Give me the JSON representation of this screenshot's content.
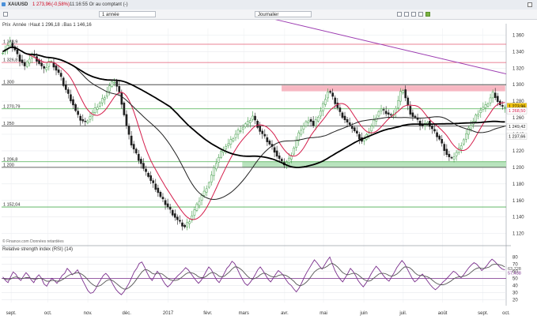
{
  "header": {
    "instrument": "XAUUSD",
    "price": "1 273,96",
    "change": "(-0,58%)",
    "time": "11:16:55 Or au comptant (-)",
    "change_color": "#d0021b",
    "icons": [
      "menu-icon",
      "window-control-icon"
    ]
  },
  "toolbar": {
    "period_label": "1 année",
    "interval_label": "Journalier",
    "icons": [
      "expand-icon",
      "settings-icon",
      "indicator-icon",
      "draw-icon",
      "chart-type-icon",
      "zoom-icon"
    ]
  },
  "chart_data": [
    {
      "type": "candlestick",
      "title": "Prix",
      "info": "Année ↑Haut 1 296,18 ↓Bas 1 146,16",
      "source": "© Finance.com Données retardées",
      "y_ticks": [
        1120,
        1140,
        1160,
        1180,
        1200,
        1220,
        1240,
        1260,
        1280,
        1300,
        1320,
        1340,
        1360
      ],
      "ylim": [
        1112,
        1368
      ],
      "x_tick_labels": [
        "sept.",
        "oct.",
        "nov.",
        "déc.",
        "2017",
        "févr.",
        "mars",
        "avr.",
        "mai",
        "juin",
        "juil.",
        "août",
        "sept.",
        "oct."
      ],
      "x_tick_fractions": [
        0.019,
        0.092,
        0.171,
        0.248,
        0.33,
        0.409,
        0.48,
        0.561,
        0.638,
        0.718,
        0.796,
        0.874,
        0.954,
        1.0
      ],
      "series_close": [
        1340,
        1343,
        1347,
        1350,
        1346,
        1342,
        1336,
        1330,
        1327,
        1322,
        1326,
        1332,
        1336,
        1334,
        1330,
        1326,
        1322,
        1318,
        1322,
        1328,
        1327,
        1323,
        1318,
        1314,
        1308,
        1300,
        1294,
        1288,
        1282,
        1276,
        1268,
        1262,
        1258,
        1256,
        1254,
        1258,
        1262,
        1266,
        1270,
        1274,
        1278,
        1282,
        1286,
        1292,
        1298,
        1302,
        1304,
        1298,
        1290,
        1278,
        1264,
        1250,
        1238,
        1228,
        1222,
        1216,
        1210,
        1205,
        1198,
        1193,
        1190,
        1184,
        1180,
        1175,
        1170,
        1164,
        1160,
        1156,
        1152,
        1148,
        1144,
        1140,
        1136,
        1133,
        1130,
        1128,
        1132,
        1136,
        1142,
        1148,
        1154,
        1160,
        1166,
        1170,
        1176,
        1182,
        1190,
        1198,
        1206,
        1212,
        1218,
        1222,
        1226,
        1228,
        1232,
        1236,
        1240,
        1244,
        1246,
        1249,
        1252,
        1254,
        1258,
        1262,
        1256,
        1250,
        1244,
        1240,
        1236,
        1232,
        1228,
        1224,
        1220,
        1214,
        1210,
        1206,
        1204,
        1206,
        1210,
        1216,
        1224,
        1232,
        1240,
        1246,
        1250,
        1254,
        1258,
        1256,
        1250,
        1256,
        1262,
        1268,
        1276,
        1284,
        1292,
        1290,
        1284,
        1278,
        1272,
        1266,
        1262,
        1258,
        1254,
        1250,
        1248,
        1244,
        1240,
        1236,
        1232,
        1234,
        1238,
        1244,
        1250,
        1256,
        1262,
        1268,
        1270,
        1268,
        1266,
        1264,
        1262,
        1266,
        1272,
        1280,
        1290,
        1294,
        1284,
        1274,
        1266,
        1262,
        1260,
        1256,
        1252,
        1250,
        1252,
        1256,
        1250,
        1246,
        1242,
        1238,
        1234,
        1228,
        1222,
        1216,
        1212,
        1210,
        1214,
        1218,
        1222,
        1228,
        1234,
        1240,
        1246,
        1252,
        1256,
        1262,
        1266,
        1270,
        1272,
        1274,
        1278,
        1284,
        1290,
        1286,
        1280,
        1275,
        1272,
        1274
      ],
      "range_bounds": [
        [
          1314,
          1372
        ],
        [
          1172,
          1262
        ],
        [
          1120,
          1176
        ],
        [
          1192,
          1226
        ],
        [
          1276,
          1298
        ]
      ],
      "moving_averages": [
        {
          "color": "#d41c4a",
          "width": 1.0
        },
        {
          "color": "#222222",
          "width": 1.0
        },
        {
          "color": "#000000",
          "width": 1.8
        }
      ],
      "horizontal_levels": [
        {
          "value": 1348.9,
          "label": "1 348,9",
          "color": "#e35a72"
        },
        {
          "value": 1326.8,
          "label": "1 326,8",
          "color": "#e35a72"
        },
        {
          "value": 1300,
          "label": "1 300",
          "color": "#333333"
        },
        {
          "value": 1270.79,
          "label": "1 270,79",
          "color": "#4caf50"
        },
        {
          "value": 1250,
          "label": "1 250",
          "color": "#333333"
        },
        {
          "value": 1206.8,
          "label": "1 206,8",
          "color": "#4caf50"
        },
        {
          "value": 1200,
          "label": "1 200",
          "color": "#333333"
        },
        {
          "value": 1152.04,
          "label": "1 152,04",
          "color": "#4caf50"
        }
      ],
      "zones": [
        {
          "from": 1292,
          "to": 1299,
          "start_fraction": 0.555,
          "end_fraction": 0.998,
          "color": "#f7b7c2"
        },
        {
          "from": 1200,
          "to": 1206.8,
          "start_fraction": 0.477,
          "end_fraction": 1.0,
          "color": "#b8e3bd"
        }
      ],
      "trendline": {
        "start_fraction": 0.5,
        "start_value": 1385,
        "end_fraction": 1.0,
        "end_value": 1313,
        "color": "#9b3ab0"
      },
      "price_labels": [
        {
          "value": 1273.96,
          "label": "1 273,96",
          "bg": "#f1c40f",
          "fg": "#000000"
        },
        {
          "value": 1268.5,
          "label": "1 268,50",
          "bg": "#ffffff",
          "fg": "#d41c4a"
        },
        {
          "value": 1249.42,
          "label": "1 249,42",
          "bg": "#ffffff",
          "fg": "#222222"
        },
        {
          "value": 1237.66,
          "label": "1 237,66",
          "bg": "#ffffff",
          "fg": "#000000"
        }
      ]
    },
    {
      "type": "line",
      "title": "Relative strength index (RSI) (14)",
      "y_ticks": [
        20,
        30,
        40,
        50,
        60,
        70,
        80
      ],
      "ylim": [
        16,
        86
      ],
      "reference_level": 50,
      "reference_color": "#7a2e8c",
      "series": [
        {
          "name": "RSI",
          "color": "#7a2e8c",
          "values": [
            52,
            47,
            44,
            52,
            59,
            56,
            50,
            47,
            53,
            58,
            54,
            48,
            44,
            51,
            55,
            50,
            42,
            39,
            45,
            50,
            47,
            43,
            48,
            54,
            57,
            64,
            60,
            55,
            58,
            62,
            55,
            47,
            40,
            33,
            29,
            30,
            35,
            42,
            48,
            54,
            57,
            53,
            47,
            40,
            34,
            30,
            27,
            31,
            37,
            43,
            51,
            59,
            64,
            71,
            73,
            66,
            58,
            51,
            47,
            54,
            60,
            55,
            48,
            42,
            38,
            41,
            46,
            50,
            54,
            57,
            61,
            65,
            62,
            57,
            52,
            47,
            43,
            47,
            53,
            60,
            66,
            62,
            55,
            48,
            44,
            50,
            57,
            64,
            68,
            74,
            71,
            64,
            56,
            49,
            43,
            40,
            44,
            49,
            55,
            62,
            66,
            61,
            55,
            49,
            45,
            50,
            56,
            61,
            58,
            54,
            48,
            43,
            40,
            35,
            31,
            36,
            43,
            51,
            58,
            64,
            70,
            76,
            72,
            67,
            63,
            69,
            75,
            80,
            70,
            61,
            54,
            49,
            45,
            51,
            57,
            64,
            60,
            54,
            47,
            42,
            38,
            43,
            49,
            56,
            62,
            67,
            63,
            58,
            53,
            49,
            46,
            52,
            58,
            65,
            70,
            75,
            71,
            64,
            57,
            50,
            45,
            48,
            53,
            56,
            51,
            46,
            41,
            37,
            34,
            37,
            41,
            45,
            48,
            52,
            56,
            60,
            58,
            54,
            51,
            55,
            60,
            65,
            69,
            72,
            70,
            66,
            61,
            64,
            68,
            73,
            77,
            74,
            70,
            66,
            63,
            62
          ]
        },
        {
          "name": "signal",
          "color": "#555555",
          "values": [
            50,
            49,
            48,
            49,
            51,
            52,
            51,
            50,
            50,
            51,
            51,
            50,
            49,
            49,
            50,
            50,
            48,
            46,
            46,
            47,
            47,
            46,
            46,
            48,
            50,
            53,
            55,
            56,
            57,
            58,
            57,
            55,
            52,
            48,
            44,
            41,
            39,
            39,
            40,
            43,
            46,
            48,
            48,
            46,
            43,
            40,
            37,
            35,
            35,
            37,
            40,
            44,
            49,
            54,
            59,
            62,
            62,
            60,
            57,
            56,
            57,
            57,
            56,
            53,
            50,
            48,
            47,
            47,
            48,
            50,
            53,
            56,
            58,
            58,
            57,
            55,
            52,
            51,
            51,
            53,
            56,
            58,
            58,
            56,
            53,
            52,
            53,
            56,
            59,
            63,
            66,
            66,
            64,
            61,
            57,
            53,
            50,
            49,
            50,
            52,
            55,
            57,
            57,
            55,
            53,
            52,
            52,
            54,
            55,
            55,
            54,
            52,
            49,
            46,
            42,
            40,
            40,
            42,
            45,
            49,
            54,
            59,
            62,
            64,
            64,
            65,
            67,
            70,
            71,
            69,
            66,
            62,
            58,
            56,
            55,
            56,
            57,
            57,
            55,
            52,
            49,
            47,
            46,
            47,
            50,
            53,
            56,
            57,
            57,
            56,
            54,
            53,
            54,
            56,
            59,
            63,
            66,
            66,
            65,
            62,
            58,
            55,
            54,
            54,
            53,
            52,
            50,
            47,
            44,
            42,
            41,
            41,
            42,
            44,
            46,
            49,
            51,
            52,
            52,
            53,
            54,
            56,
            59,
            62,
            64,
            65,
            64,
            64,
            65,
            66,
            69,
            70,
            70,
            69,
            68,
            66
          ]
        }
      ],
      "right_labels": [
        {
          "value": 63.728,
          "label": "63,728",
          "color": "#555555"
        },
        {
          "value": 57.438,
          "label": "57,438",
          "color": "#7a2e8c"
        }
      ]
    }
  ]
}
